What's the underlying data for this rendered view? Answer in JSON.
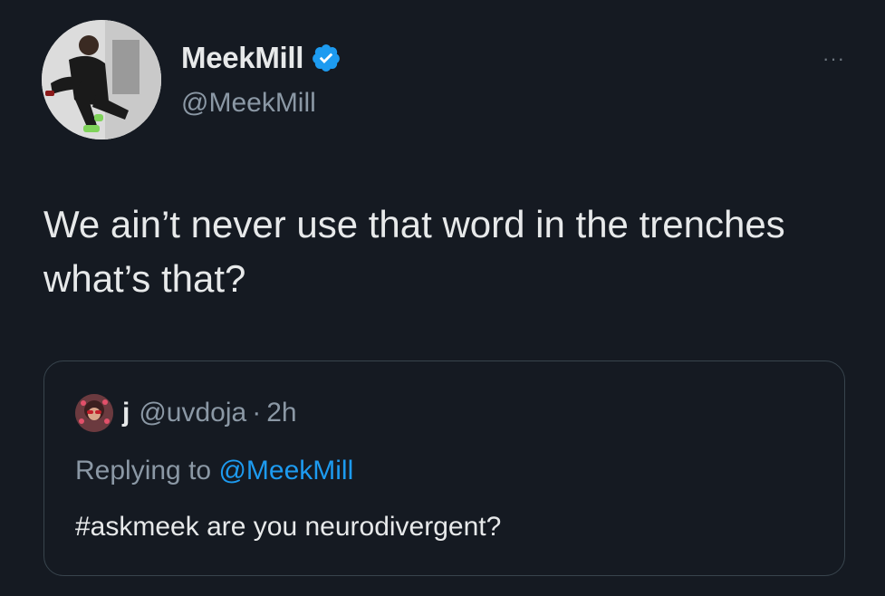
{
  "author": {
    "display_name": "MeekMill",
    "handle": "@MeekMill",
    "verified": true,
    "avatar_icon": "user-avatar"
  },
  "more_menu": {
    "icon": "more-horizontal-icon",
    "label": "···"
  },
  "tweet": {
    "text": "We ain’t never use that word in the trenches what’s that?"
  },
  "quoted": {
    "display_name": "j",
    "handle": "@uvdoja",
    "separator": "·",
    "time": "2h",
    "replying_prefix": "Replying to",
    "replying_to": "@MeekMill",
    "text": "#askmeek are you neurodivergent?"
  },
  "colors": {
    "background": "#151a22",
    "text_primary": "#e7e9ea",
    "text_secondary": "#8b98a5",
    "accent": "#1d9bf0",
    "border": "#38444d"
  }
}
